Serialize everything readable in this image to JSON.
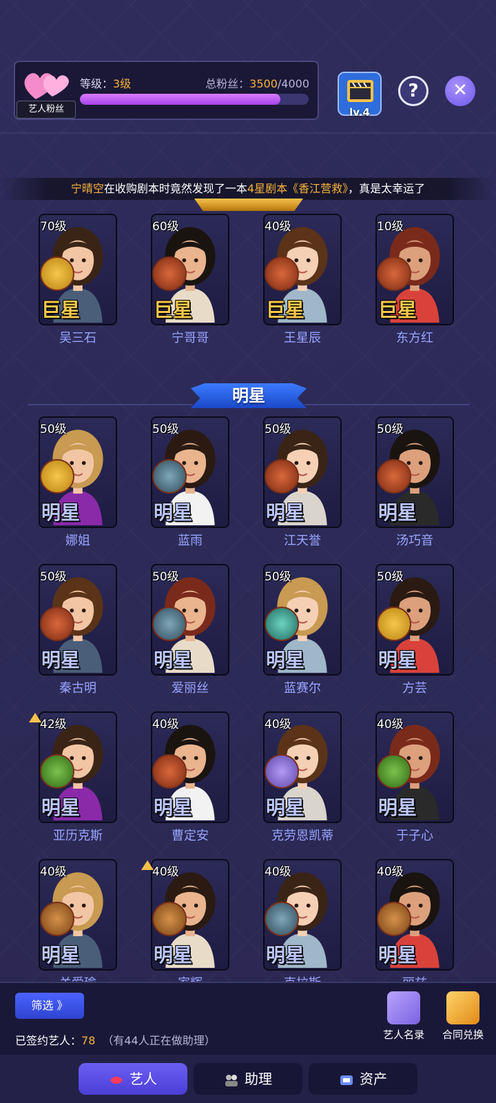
{
  "header": {
    "fan_badge": "艺人粉丝",
    "level_label": "等级：",
    "level_value": "3级",
    "fans_label": "总粉丝：",
    "fans_current": "3500",
    "fans_total": "/4000",
    "fans_progress": 0.875,
    "lv_badge": "lv.4",
    "help_icon": "?",
    "close_icon": "✕"
  },
  "ticker": {
    "player": "宁晴空",
    "text1": "在收购剧本时竟然发现了一本",
    "hl": "4星剧本《香江营救》",
    "text2": "，真是太幸运了"
  },
  "section_star": "明星",
  "superstars": [
    {
      "level": "70级",
      "rank": "巨星",
      "name": "吴三石",
      "badge": "soldier"
    },
    {
      "level": "60级",
      "rank": "巨星",
      "name": "宁哥哥",
      "badge": "silhouette"
    },
    {
      "level": "40级",
      "rank": "巨星",
      "name": "王星辰",
      "badge": "silhouette"
    },
    {
      "level": "10级",
      "rank": "巨星",
      "name": "东方红",
      "badge": "silhouette"
    }
  ],
  "stars": [
    {
      "level": "50级",
      "rank": "明星",
      "name": "娜姐",
      "badge": "soldier"
    },
    {
      "level": "50级",
      "rank": "明星",
      "name": "蓝雨",
      "badge": "ufo"
    },
    {
      "level": "50级",
      "rank": "明星",
      "name": "江天誉",
      "badge": "silhouette"
    },
    {
      "level": "50级",
      "rank": "明星",
      "name": "汤巧音",
      "badge": "silhouette"
    },
    {
      "level": "50级",
      "rank": "明星",
      "name": "秦古明",
      "badge": "silhouette"
    },
    {
      "level": "50级",
      "rank": "明星",
      "name": "爱丽丝",
      "badge": "ufo"
    },
    {
      "level": "50级",
      "rank": "明星",
      "name": "蓝赛尔",
      "badge": "tree"
    },
    {
      "level": "50级",
      "rank": "明星",
      "name": "方芸",
      "badge": "soldier"
    },
    {
      "level": "42级",
      "rank": "明星",
      "name": "亚历克斯",
      "badge": "liberty",
      "up": true
    },
    {
      "level": "40级",
      "rank": "明星",
      "name": "曹定安",
      "badge": "silhouette"
    },
    {
      "level": "40级",
      "rank": "明星",
      "name": "克劳恩凯蒂",
      "badge": "magnifier"
    },
    {
      "level": "40级",
      "rank": "明星",
      "name": "于子心",
      "badge": "liberty"
    },
    {
      "level": "40级",
      "rank": "明星",
      "name": "关爱瑜",
      "badge": "couple"
    },
    {
      "level": "40级",
      "rank": "明星",
      "name": "家辉",
      "badge": "couple",
      "up": true
    },
    {
      "level": "40级",
      "rank": "明星",
      "name": "克拉斯",
      "badge": "ufo"
    },
    {
      "level": "40级",
      "rank": "明星",
      "name": "丽兹",
      "badge": "couple"
    }
  ],
  "bottom": {
    "filter_label": "筛选 》",
    "signed_label": "已签约艺人：",
    "signed_count": "78",
    "signed_note": "（有44人正在做助理）",
    "roster_label": "艺人名录",
    "contract_label": "合同兑换"
  },
  "tabs": [
    {
      "label": "艺人",
      "active": true
    },
    {
      "label": "助理",
      "active": false
    },
    {
      "label": "资产",
      "active": false
    }
  ],
  "colors": {
    "accent_gold": "#f7b23b",
    "star_name": "#98a6ff",
    "progress_fill": "#c05cf2"
  }
}
